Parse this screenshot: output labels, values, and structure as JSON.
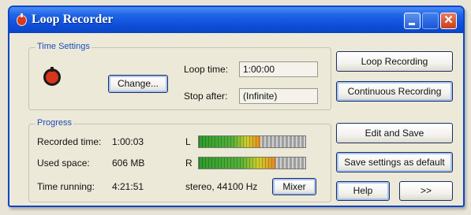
{
  "window": {
    "title": "Loop Recorder"
  },
  "time_settings": {
    "group_label": "Time Settings",
    "change_label": "Change...",
    "loop_time_label": "Loop time:",
    "loop_time_value": "1:00:00",
    "stop_after_label": "Stop after:",
    "stop_after_value": "(Infinite)"
  },
  "progress": {
    "group_label": "Progress",
    "recorded_time_label": "Recorded time:",
    "recorded_time_value": "1:00:03",
    "used_space_label": "Used space:",
    "used_space_value": "606 MB",
    "time_running_label": "Time running:",
    "time_running_value": "4:21:51",
    "left_channel_label": "L",
    "right_channel_label": "R",
    "left_level": 0.58,
    "right_level": 0.72,
    "format_text": "stereo, 44100 Hz",
    "mixer_label": "Mixer"
  },
  "actions": {
    "loop_recording": "Loop Recording",
    "continuous_recording": "Continuous Recording",
    "edit_and_save": "Edit and Save",
    "save_settings_default": "Save settings as default",
    "help": "Help",
    "more": ">>"
  },
  "icons": {
    "app": "record-icon",
    "minimize": "minimize-icon",
    "maximize": "maximize-icon",
    "close": "close-icon"
  }
}
